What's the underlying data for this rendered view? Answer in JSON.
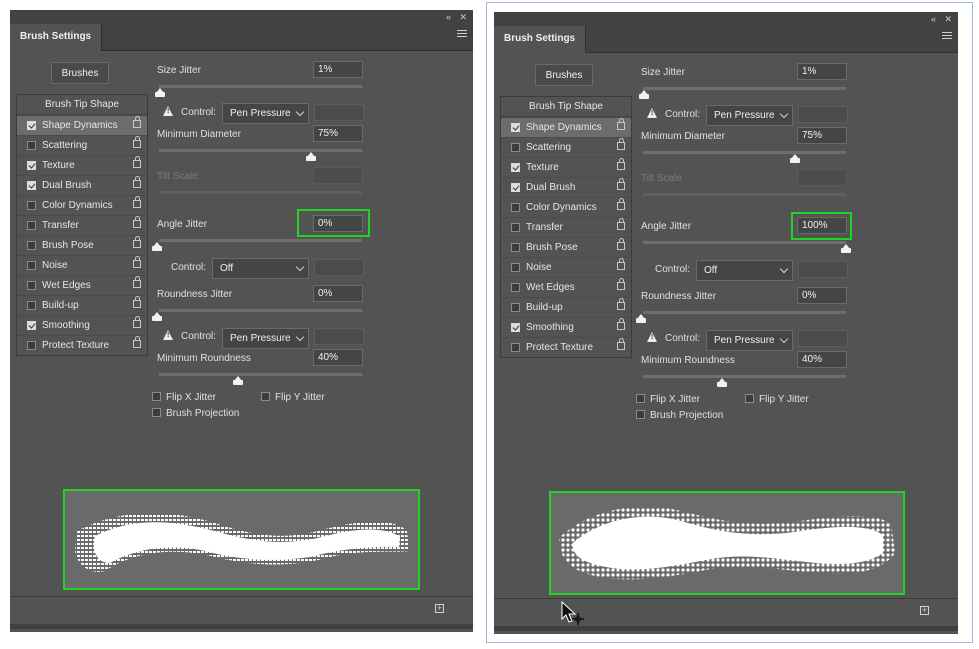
{
  "left_panel": {
    "topbar_icons": {
      "collapse": "«",
      "close": "✕"
    },
    "tab_title": "Brush Settings",
    "brushes_button": "Brushes",
    "list_header": "Brush Tip Shape",
    "items": [
      {
        "label": "Shape Dynamics",
        "checked": true,
        "selected": true
      },
      {
        "label": "Scattering",
        "checked": false
      },
      {
        "label": "Texture",
        "checked": true
      },
      {
        "label": "Dual Brush",
        "checked": true
      },
      {
        "label": "Color Dynamics",
        "checked": false
      },
      {
        "label": "Transfer",
        "checked": false
      },
      {
        "label": "Brush Pose",
        "checked": false
      },
      {
        "label": "Noise",
        "checked": false
      },
      {
        "label": "Wet Edges",
        "checked": false
      },
      {
        "label": "Build-up",
        "checked": false
      },
      {
        "label": "Smoothing",
        "checked": true
      },
      {
        "label": "Protect Texture",
        "checked": false
      }
    ],
    "size_jitter": {
      "label": "Size Jitter",
      "value": "1%"
    },
    "control1": {
      "label": "Control:",
      "value": "Pen Pressure"
    },
    "min_diameter": {
      "label": "Minimum Diameter",
      "value": "75%"
    },
    "tilt_scale": {
      "label": "Tilt Scale",
      "value": ""
    },
    "angle_jitter": {
      "label": "Angle Jitter",
      "value": "0%"
    },
    "control2": {
      "label": "Control:",
      "value": "Off"
    },
    "roundness_jitter": {
      "label": "Roundness Jitter",
      "value": "0%"
    },
    "control3": {
      "label": "Control:",
      "value": "Pen Pressure"
    },
    "min_roundness": {
      "label": "Minimum Roundness",
      "value": "40%"
    },
    "flip_x": "Flip X Jitter",
    "flip_y": "Flip Y Jitter",
    "brush_projection": "Brush Projection",
    "new_icon": "+"
  },
  "right_panel": {
    "topbar_icons": {
      "collapse": "«",
      "close": "✕"
    },
    "tab_title": "Brush Settings",
    "brushes_button": "Brushes",
    "list_header": "Brush Tip Shape",
    "items": [
      {
        "label": "Shape Dynamics",
        "checked": true,
        "selected": true
      },
      {
        "label": "Scattering",
        "checked": false
      },
      {
        "label": "Texture",
        "checked": true
      },
      {
        "label": "Dual Brush",
        "checked": true
      },
      {
        "label": "Color Dynamics",
        "checked": false
      },
      {
        "label": "Transfer",
        "checked": false
      },
      {
        "label": "Brush Pose",
        "checked": false
      },
      {
        "label": "Noise",
        "checked": false
      },
      {
        "label": "Wet Edges",
        "checked": false
      },
      {
        "label": "Build-up",
        "checked": false
      },
      {
        "label": "Smoothing",
        "checked": true
      },
      {
        "label": "Protect Texture",
        "checked": false
      }
    ],
    "size_jitter": {
      "label": "Size Jitter",
      "value": "1%"
    },
    "control1": {
      "label": "Control:",
      "value": "Pen Pressure"
    },
    "min_diameter": {
      "label": "Minimum Diameter",
      "value": "75%"
    },
    "tilt_scale": {
      "label": "Tilt Scale",
      "value": ""
    },
    "angle_jitter": {
      "label": "Angle Jitter",
      "value": "100%"
    },
    "control2": {
      "label": "Control:",
      "value": "Off"
    },
    "roundness_jitter": {
      "label": "Roundness Jitter",
      "value": "0%"
    },
    "control3": {
      "label": "Control:",
      "value": "Pen Pressure"
    },
    "min_roundness": {
      "label": "Minimum Roundness",
      "value": "40%"
    },
    "flip_x": "Flip X Jitter",
    "flip_y": "Flip Y Jitter",
    "brush_projection": "Brush Projection",
    "new_icon": "+"
  },
  "colors": {
    "highlight": "#21d421",
    "panel_bg": "#535353",
    "header_bg": "#424242"
  },
  "icons": [
    "double-chevron-left-icon",
    "close-icon",
    "panel-menu-icon",
    "lock-icon",
    "warning-icon",
    "new-brush-icon",
    "mouse-cursor-icon"
  ]
}
